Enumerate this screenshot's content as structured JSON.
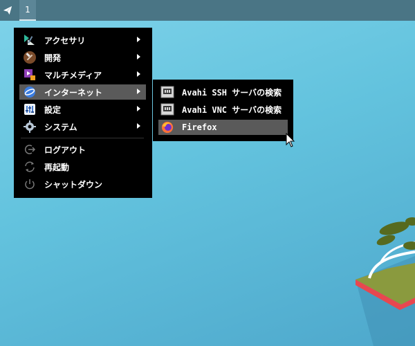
{
  "panel": {
    "launcher_icon": "paper-plane-icon",
    "workspace_number": "1"
  },
  "main_menu": {
    "items": [
      {
        "label": "アクセサリ",
        "icon": "accessories-icon",
        "has_submenu": true
      },
      {
        "label": "開発",
        "icon": "development-icon",
        "has_submenu": true
      },
      {
        "label": "マルチメディア",
        "icon": "multimedia-icon",
        "has_submenu": true
      },
      {
        "label": "インターネット",
        "icon": "internet-icon",
        "has_submenu": true,
        "active": true
      },
      {
        "label": "設定",
        "icon": "settings-icon",
        "has_submenu": true
      },
      {
        "label": "システム",
        "icon": "system-icon",
        "has_submenu": true
      },
      {
        "label": "ログアウト",
        "icon": "logout-icon",
        "has_submenu": false
      },
      {
        "label": "再起動",
        "icon": "restart-icon",
        "has_submenu": false
      },
      {
        "label": "シャットダウン",
        "icon": "shutdown-icon",
        "has_submenu": false
      }
    ]
  },
  "internet_submenu": {
    "items": [
      {
        "label": "Avahi SSH サーバの検索",
        "icon": "network-server-icon"
      },
      {
        "label": "Avahi VNC サーバの検索",
        "icon": "network-server-icon"
      },
      {
        "label": "Firefox",
        "icon": "firefox-icon",
        "active": true
      }
    ]
  },
  "colors": {
    "menu_bg": "#000000",
    "menu_highlight": "#5a5a5a",
    "panel_bg": "#4a7585",
    "desktop_bg": "#63c3de"
  }
}
